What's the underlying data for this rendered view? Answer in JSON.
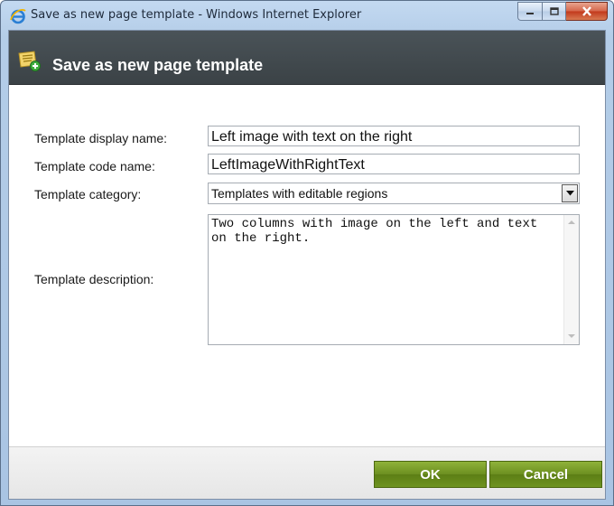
{
  "window": {
    "title": "Save as new page template - Windows Internet Explorer",
    "icon": "internet-explorer-icon",
    "controls": [
      "minimize",
      "maximize",
      "close"
    ]
  },
  "dialog": {
    "title": "Save as new page template",
    "icon": "template-add-icon"
  },
  "form": {
    "display_name": {
      "label": "Template display name:",
      "value": "Left image with text on the right"
    },
    "code_name": {
      "label": "Template code name:",
      "value": "LeftImageWithRightText"
    },
    "category": {
      "label": "Template category:",
      "selected": "Templates with editable regions"
    },
    "description": {
      "label": "Template description:",
      "value": "Two columns with image on the left and text on the right."
    }
  },
  "buttons": {
    "ok": "OK",
    "cancel": "Cancel"
  },
  "colors": {
    "header_bg": "#3f474b",
    "button_green": "#6c8f20",
    "close_red": "#c2381b"
  }
}
